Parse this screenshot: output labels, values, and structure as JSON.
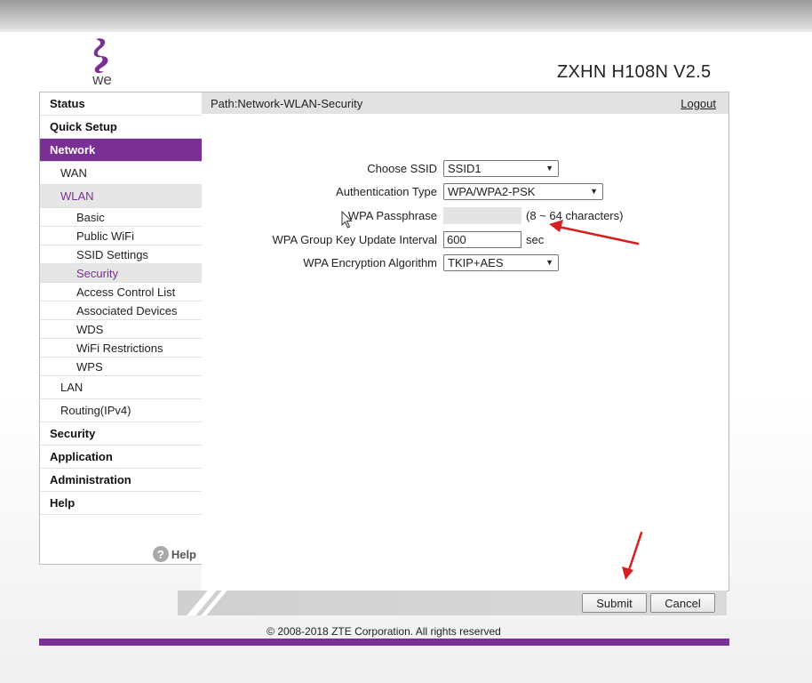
{
  "brand": {
    "logo_text": "we",
    "model": "ZXHN H108N V2.5",
    "accent": "#7a2f94"
  },
  "path": {
    "label": "Path:Network-WLAN-Security",
    "logout": "Logout"
  },
  "menu": {
    "status": "Status",
    "quick_setup": "Quick Setup",
    "network": "Network",
    "wan": "WAN",
    "wlan": "WLAN",
    "wlan_items": [
      "Basic",
      "Public WiFi",
      "SSID Settings",
      "Security",
      "Access Control List",
      "Associated Devices",
      "WDS",
      "WiFi Restrictions",
      "WPS"
    ],
    "lan": "LAN",
    "routing": "Routing(IPv4)",
    "security": "Security",
    "application": "Application",
    "administration": "Administration",
    "help": "Help"
  },
  "help_link": {
    "icon": "?",
    "label": "Help"
  },
  "form": {
    "ssid_label": "Choose SSID",
    "ssid_value": "SSID1",
    "auth_label": "Authentication Type",
    "auth_value": "WPA/WPA2-PSK",
    "pass_label": "WPA Passphrase",
    "pass_value": "",
    "pass_hint": "(8 ~ 64 characters)",
    "gki_label": "WPA Group Key Update Interval",
    "gki_value": "600",
    "gki_unit": "sec",
    "enc_label": "WPA Encryption Algorithm",
    "enc_value": "TKIP+AES"
  },
  "buttons": {
    "submit": "Submit",
    "cancel": "Cancel"
  },
  "footer": {
    "copyright": "© 2008-2018 ZTE Corporation. All rights reserved"
  }
}
